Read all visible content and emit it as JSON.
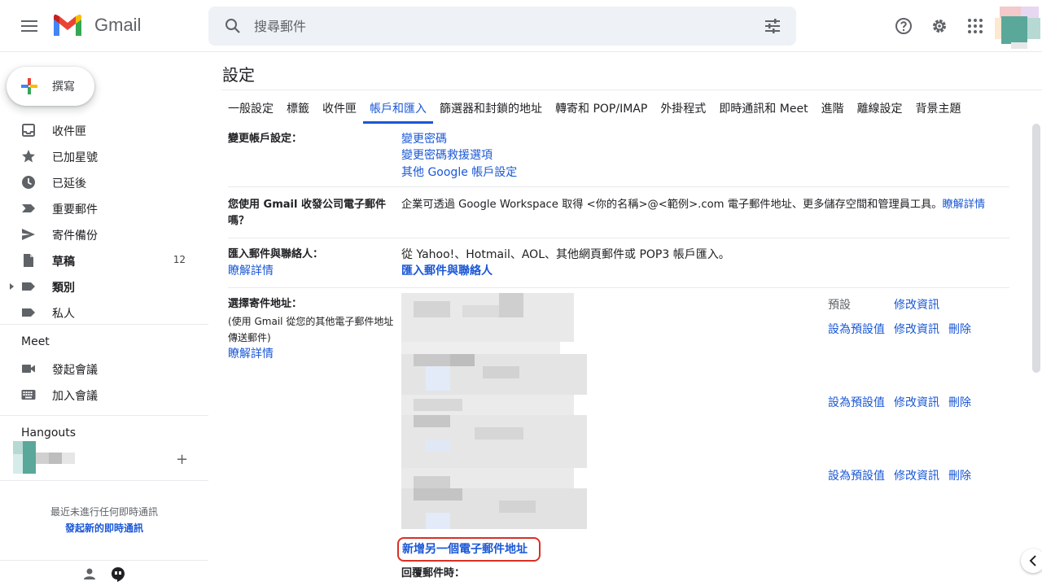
{
  "header": {
    "brand": "Gmail",
    "search_placeholder": "搜尋郵件"
  },
  "sidebar": {
    "compose_label": "撰寫",
    "items": [
      {
        "label": "收件匣",
        "icon": "inbox-icon"
      },
      {
        "label": "已加星號",
        "icon": "star-icon"
      },
      {
        "label": "已延後",
        "icon": "clock-icon"
      },
      {
        "label": "重要郵件",
        "icon": "important-icon"
      },
      {
        "label": "寄件備份",
        "icon": "send-icon"
      },
      {
        "label": "草稿",
        "icon": "draft-icon",
        "count": "12"
      },
      {
        "label": "類別",
        "icon": "label-icon"
      },
      {
        "label": "私人",
        "icon": "label-icon"
      }
    ],
    "meet": {
      "title": "Meet",
      "items": [
        {
          "label": "發起會議",
          "icon": "video-icon"
        },
        {
          "label": "加入會議",
          "icon": "keyboard-icon"
        }
      ]
    },
    "hangouts": {
      "title": "Hangouts",
      "empty_text": "最近未進行任何即時通訊",
      "start_link": "發起新的即時通訊"
    }
  },
  "settings": {
    "title": "設定",
    "tabs": [
      {
        "label": "一般設定"
      },
      {
        "label": "標籤"
      },
      {
        "label": "收件匣"
      },
      {
        "label": "帳戶和匯入",
        "active": true
      },
      {
        "label": "篩選器和封鎖的地址"
      },
      {
        "label": "轉寄和 POP/IMAP"
      },
      {
        "label": "外掛程式"
      },
      {
        "label": "即時通訊和 Meet"
      },
      {
        "label": "進階"
      },
      {
        "label": "離線設定"
      },
      {
        "label": "背景主題"
      }
    ],
    "change_account": {
      "label": "變更帳戶設定：",
      "links": [
        "變更密碼",
        "變更密碼救援選項",
        "其他 Google 帳戶設定"
      ]
    },
    "workspace": {
      "label_line1": "您使用 Gmail 收發公司電子郵件",
      "label_line2": "嗎？",
      "text": "企業可透過 Google Workspace 取得 <你的名稱>@<範例>.com 電子郵件地址、更多儲存空間和管理員工具。",
      "link": "瞭解詳情"
    },
    "import": {
      "label": "匯入郵件與聯絡人：",
      "learn_more": "瞭解詳情",
      "text": "從 Yahoo!、Hotmail、AOL、其他網頁郵件或 POP3 帳戶匯入。",
      "link": "匯入郵件與聯絡人"
    },
    "send_as": {
      "label": "選擇寄件地址：",
      "sub_line1": "(使用 Gmail 從您的其他電子郵件地址",
      "sub_line2": "傳送郵件)",
      "learn_more": "瞭解詳情",
      "default_label": "預設",
      "edit_link": "修改資訊",
      "set_default_link": "設為預設值",
      "delete_link": "刪除",
      "add_link": "新增另一個電子郵件地址"
    },
    "reply": {
      "label": "回覆郵件時："
    }
  }
}
